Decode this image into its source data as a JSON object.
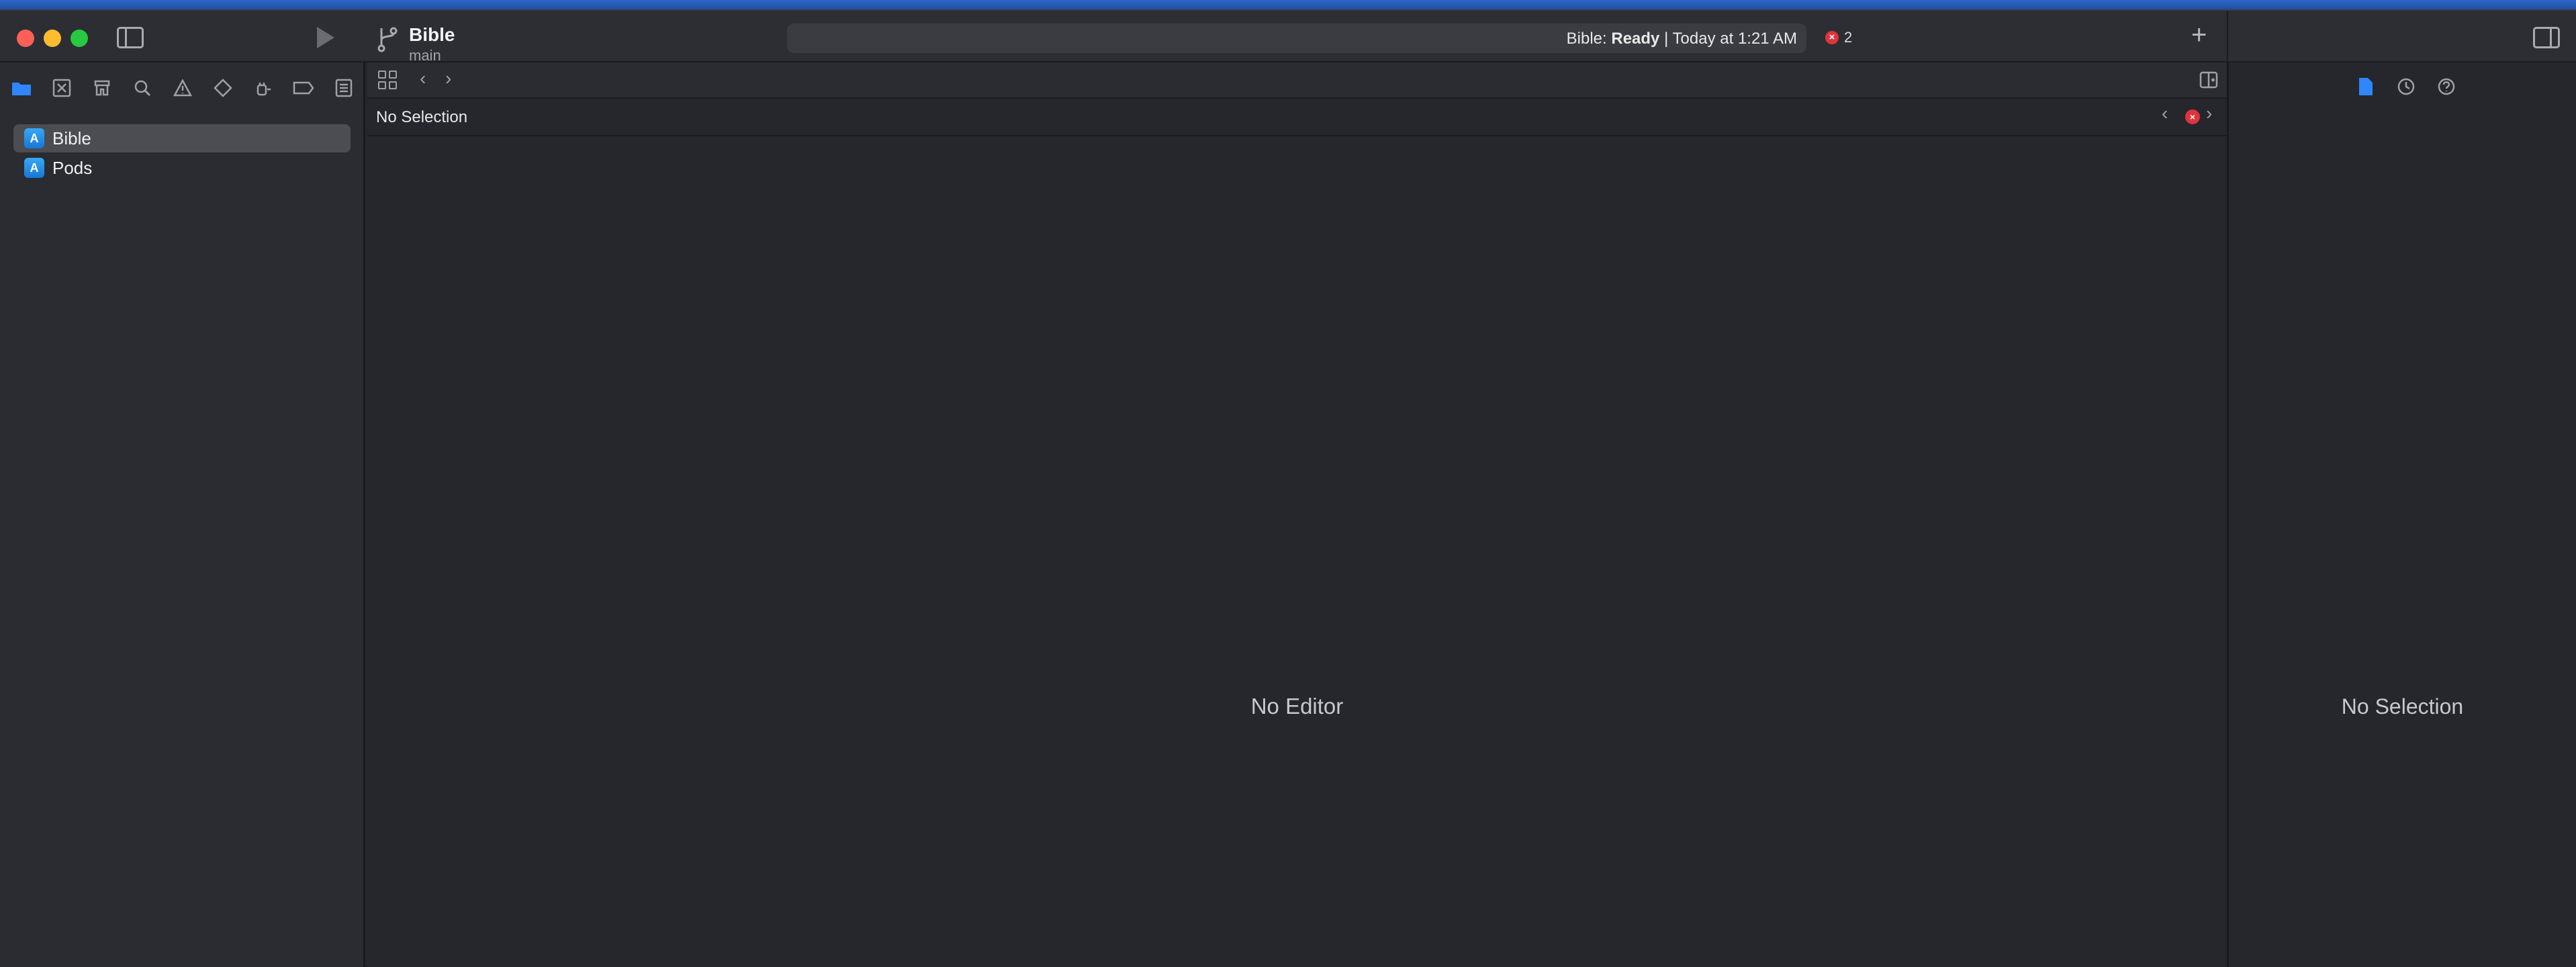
{
  "window": {
    "project_title": "Bible",
    "branch": "main",
    "activity": {
      "prefix": "Bible: ",
      "status": "Ready",
      "separator": " | ",
      "time": "Today at 1:21 AM"
    },
    "error_count": "2"
  },
  "navigator": {
    "tabs": [
      {
        "name": "project-navigator-icon"
      },
      {
        "name": "source-control-icon"
      },
      {
        "name": "symbol-navigator-icon"
      },
      {
        "name": "find-navigator-icon"
      },
      {
        "name": "issue-navigator-icon"
      },
      {
        "name": "test-navigator-icon"
      },
      {
        "name": "debug-navigator-icon"
      },
      {
        "name": "breakpoint-navigator-icon"
      },
      {
        "name": "report-navigator-icon"
      }
    ],
    "items": [
      {
        "label": "Bible",
        "selected": true
      },
      {
        "label": "Pods",
        "selected": false
      }
    ]
  },
  "editor": {
    "jump_bar_title": "No Selection",
    "empty_message": "No Editor"
  },
  "inspector": {
    "empty_message": "No Selection"
  },
  "colors": {
    "accent": "#2f86ff",
    "error": "#e0343b",
    "close": "#fe5f57",
    "minimize": "#febc2e",
    "zoom": "#28c840"
  }
}
